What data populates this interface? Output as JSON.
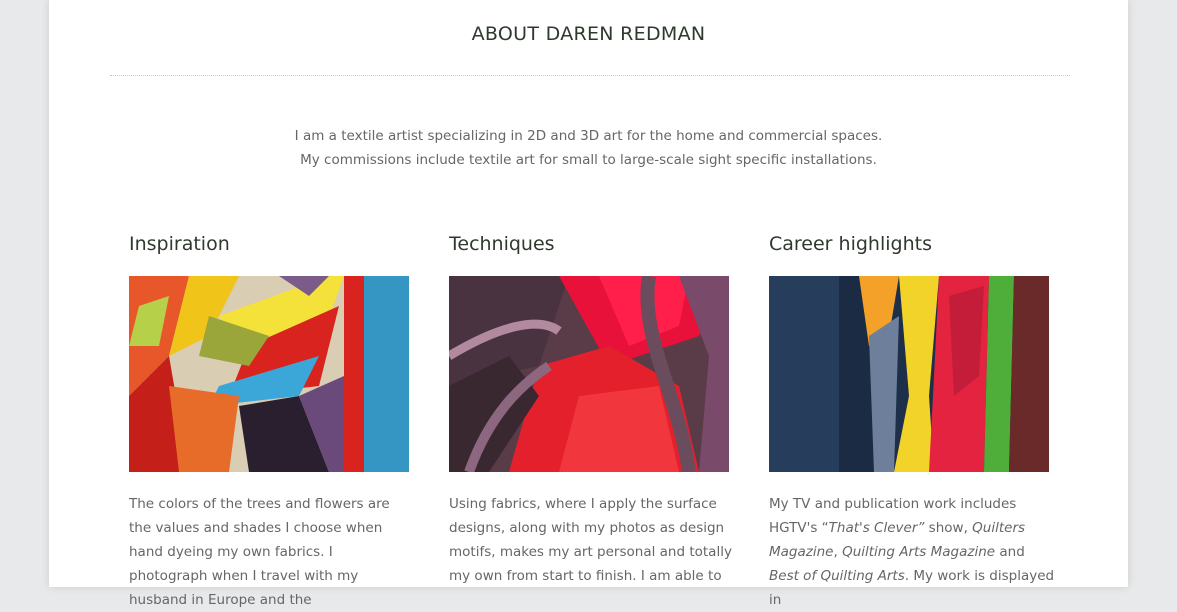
{
  "page": {
    "title": "ABOUT DAREN REDMAN",
    "intro_line1": "I am a textile artist specializing in 2D and 3D art for the home and commercial spaces.",
    "intro_line2": "My commissions include textile art for small to large-scale sight specific installations."
  },
  "columns": [
    {
      "heading": "Inspiration",
      "text": "The colors of the trees and flowers are the values and shades I choose when hand dyeing my own fabrics.  I photograph when I travel with my husband in Europe and the"
    },
    {
      "heading": "Techniques",
      "text": "Using fabrics, where I apply the surface designs, along with my photos as design motifs, makes my art personal and totally my own from start to finish. I am able to"
    },
    {
      "heading": "Career highlights",
      "text_a": "My TV and publication work includes HGTV's “",
      "text_show": "That's Clever”",
      "text_b": " show, ",
      "text_pub1": "Quilters Magazine",
      "text_c": ", ",
      "text_pub2": "Quilting Arts Magazine",
      "text_d": " and ",
      "text_pub3": "Best of Quilting Arts",
      "text_e": ". My work is displayed in"
    }
  ],
  "colors": {
    "background": "#e8e9ea",
    "page": "#ffffff",
    "heading": "#2f3a2f",
    "body_text": "#666666"
  }
}
